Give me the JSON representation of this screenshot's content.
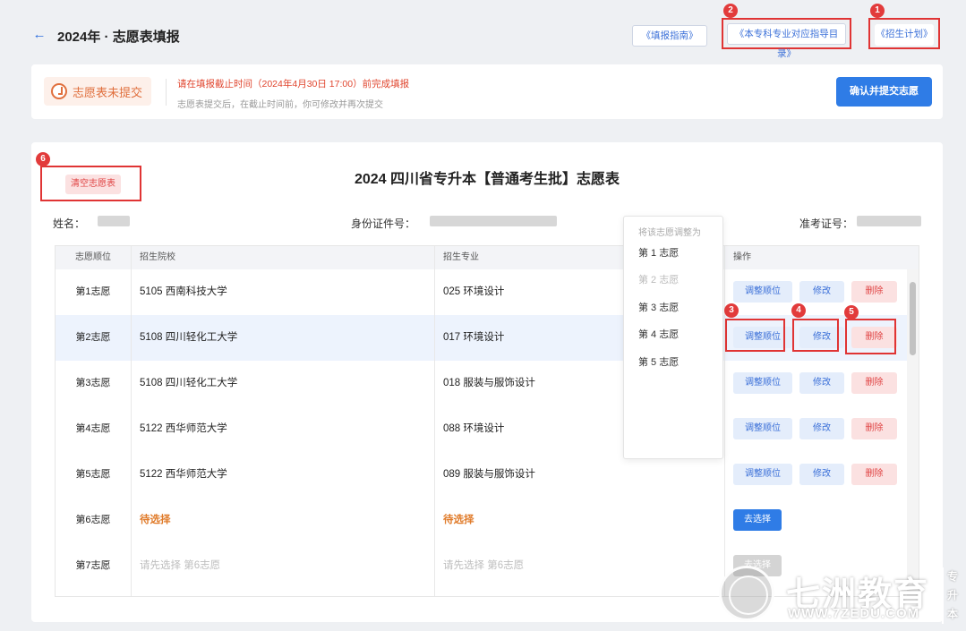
{
  "header": {
    "title": "2024年 · 志愿表填报",
    "links": [
      {
        "label": "《填报指南》"
      },
      {
        "label": "《本专科专业对应指导目录》",
        "badge": "2"
      },
      {
        "label": "《招生计划》",
        "badge": "1"
      }
    ]
  },
  "notice": {
    "status": "志愿表未提交",
    "deadline": "请在填报截止时间（2024年4月30日 17:00）前完成填报",
    "sub": "志愿表提交后，在截止时间前，你可修改并再次提交",
    "submit_label": "确认并提交志愿"
  },
  "form": {
    "title": "2024 四川省专升本【普通考生批】志愿表",
    "clear_label": "清空志愿表",
    "clear_badge": "6",
    "name_label": "姓名：",
    "id_label": "身份证件号：",
    "exam_label": "准考证号："
  },
  "table": {
    "headers": [
      "志愿顺位",
      "招生院校",
      "招生专业",
      "操作"
    ],
    "rows": [
      {
        "rank": "第1志愿",
        "school": "5105 西南科技大学",
        "major": "025 环境设计",
        "ops": [
          "调整顺位",
          "修改",
          "删除"
        ]
      },
      {
        "rank": "第2志愿",
        "school": "5108 四川轻化工大学",
        "major": "017 环境设计",
        "ops": [
          "调整顺位",
          "修改",
          "删除"
        ]
      },
      {
        "rank": "第3志愿",
        "school": "5108 四川轻化工大学",
        "major": "018 服装与服饰设计",
        "ops": [
          "调整顺位",
          "修改",
          "删除"
        ]
      },
      {
        "rank": "第4志愿",
        "school": "5122 西华师范大学",
        "major": "088 环境设计",
        "ops": [
          "调整顺位",
          "修改",
          "删除"
        ]
      },
      {
        "rank": "第5志愿",
        "school": "5122 西华师范大学",
        "major": "089 服装与服饰设计",
        "ops": [
          "调整顺位",
          "修改",
          "删除"
        ]
      },
      {
        "rank": "第6志愿",
        "school": "待选择",
        "major": "待选择",
        "ops": [
          "去选择"
        ]
      },
      {
        "rank": "第7志愿",
        "school": "请先选择 第6志愿",
        "major": "请先选择 第6志愿",
        "ops": [
          "去选择"
        ]
      }
    ],
    "row2_badges": [
      "3",
      "4",
      "5"
    ]
  },
  "dropdown": {
    "heading": "将该志愿调整为",
    "items": [
      "第 1 志愿",
      "第 2 志愿",
      "第 3 志愿",
      "第 4 志愿",
      "第 5 志愿"
    ],
    "disabled_index": 1
  },
  "watermark": {
    "text": "七洲教育",
    "url": "WWW.7ZEDU.COM",
    "side": "专升本"
  },
  "colors": {
    "accent": "#2f7ce6",
    "danger": "#e04444",
    "warning": "#e07b2a",
    "annotation": "#e03434"
  }
}
